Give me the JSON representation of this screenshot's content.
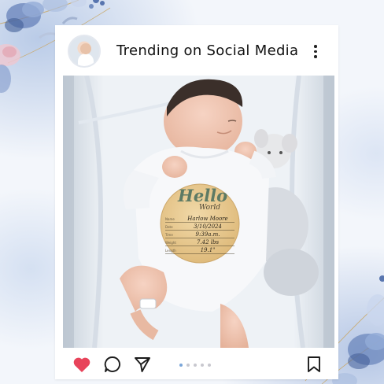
{
  "post": {
    "username": "Trending on Social Media",
    "avatar_alt": "",
    "more_icon": "more-vertical-icon",
    "photo": {
      "sign": {
        "hello": "Hello",
        "world": "World",
        "rows": [
          {
            "label": "Name",
            "value": "Harlow Moore"
          },
          {
            "label": "Date",
            "value": "3/10/2024"
          },
          {
            "label": "Time",
            "value": "9:39a.m."
          },
          {
            "label": "Weight",
            "value": "7.42 lbs"
          },
          {
            "label": "Length",
            "value": "19.1\""
          }
        ]
      }
    },
    "actions": {
      "like_icon": "heart-icon",
      "comment_icon": "comment-icon",
      "share_icon": "send-icon",
      "save_icon": "bookmark-icon",
      "liked": true,
      "carousel": {
        "count": 5,
        "active_index": 0
      }
    }
  },
  "colors": {
    "heart": "#e8435a",
    "carousel_active": "#7aa6d9",
    "carousel_inactive": "#c8c8cf",
    "sign_hello": "#5d7a64",
    "background_wash": "#b0c4e4"
  }
}
